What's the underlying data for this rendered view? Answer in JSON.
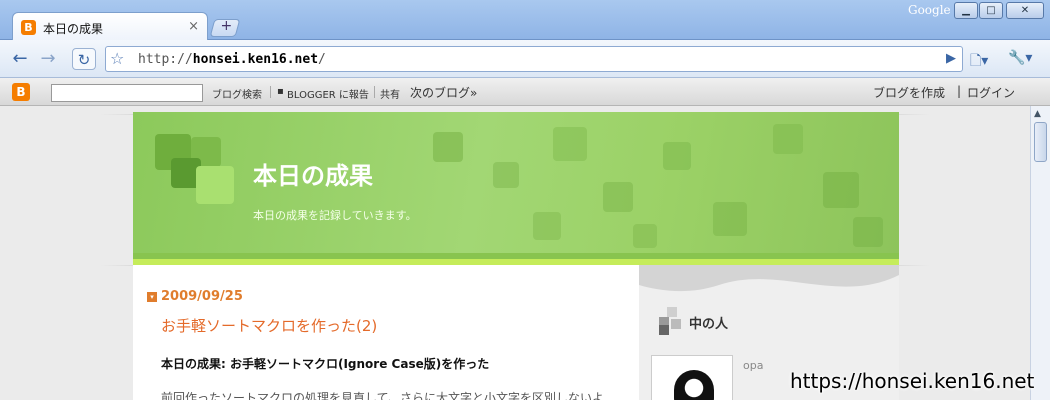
{
  "browser": {
    "tab_title": "本日の成果",
    "tab_close": "×",
    "new_tab": "+",
    "google_label": "Google",
    "url_prefix": "http://",
    "url_host": "honsei.ken16.net",
    "url_suffix": "/"
  },
  "blogger_navbar": {
    "logo": "B",
    "search_link": "ブログ検索",
    "report_link": "BLOGGER に報告",
    "share_link": "共有",
    "next_blog": "次のブログ»",
    "create_blog": "ブログを作成",
    "separator": "|",
    "login": "ログイン"
  },
  "blog": {
    "title": "本日の成果",
    "description": "本日の成果を記録していきます。"
  },
  "post": {
    "date": "2009/09/25",
    "title": "お手軽ソートマクロを作った(2)",
    "subtitle": "本日の成果: お手軽ソートマクロ(Ignore Case版)を作った",
    "body_preview": "前回作ったソートマクロの処理を見直して、さらに大文字と小文字を区別しないよ"
  },
  "sidebar": {
    "heading": "中の人",
    "profile_name": "opa"
  },
  "watermark": "https://honsei.ken16.net",
  "colors": {
    "header_green": "#9bd166",
    "accent_orange": "#e46a2a",
    "blogger_orange": "#f57d00"
  }
}
